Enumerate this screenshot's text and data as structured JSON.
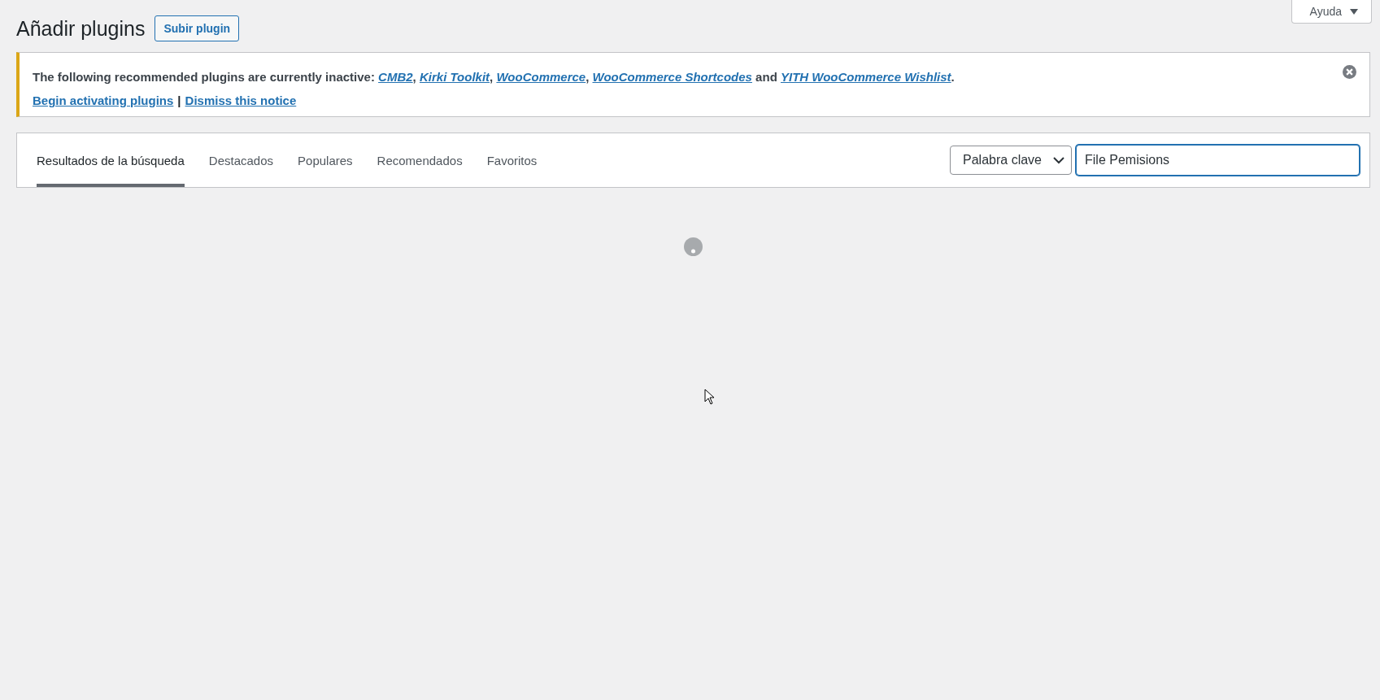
{
  "help_button": {
    "label": "Ayuda"
  },
  "page": {
    "title": "Añadir plugins",
    "upload_button": "Subir plugin"
  },
  "notice": {
    "message": [
      {
        "kind": "text",
        "text": "The following recommended plugins are currently inactive: "
      },
      {
        "kind": "link",
        "text": "CMB2"
      },
      {
        "kind": "text",
        "text": ", "
      },
      {
        "kind": "link",
        "text": "Kirki Toolkit"
      },
      {
        "kind": "text",
        "text": ", "
      },
      {
        "kind": "link",
        "text": "WooCommerce"
      },
      {
        "kind": "text",
        "text": ", "
      },
      {
        "kind": "link",
        "text": "WooCommerce Shortcodes"
      },
      {
        "kind": "text",
        "text": " and "
      },
      {
        "kind": "link",
        "text": "YITH WooCommerce Wishlist"
      },
      {
        "kind": "text",
        "text": "."
      }
    ],
    "actions": [
      "Begin activating plugins",
      "Dismiss this notice"
    ],
    "separator": "|"
  },
  "tabs": [
    {
      "label": "Resultados de la búsqueda",
      "selected": true
    },
    {
      "label": "Destacados",
      "selected": false
    },
    {
      "label": "Populares",
      "selected": false
    },
    {
      "label": "Recomendados",
      "selected": false
    },
    {
      "label": "Favoritos",
      "selected": false
    }
  ],
  "search": {
    "type_select": "Palabra clave",
    "query": "File Pemisions"
  }
}
